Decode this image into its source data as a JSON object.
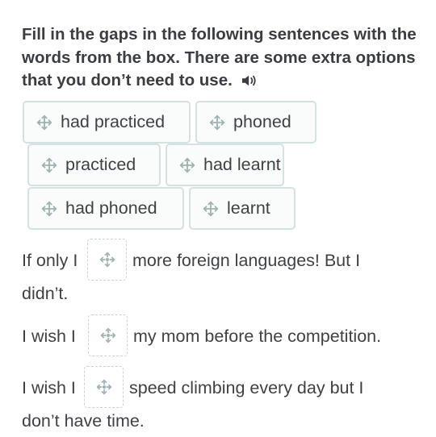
{
  "instructions": "Fill in the gaps in the following sentences with the words from the box. There are some extra options that you don’t need to use.",
  "icons": {
    "audio": "speaker-icon",
    "drag": "move-icon",
    "drop": "drop-target-icon"
  },
  "colors": {
    "chip_border": "#d4e2e2",
    "icon": "#9fb3b3",
    "text": "#3e4247"
  },
  "options": [
    {
      "label": "had practiced"
    },
    {
      "label": "phoned"
    },
    {
      "label": "practiced"
    },
    {
      "label": "had learnt"
    },
    {
      "label": "had phoned"
    },
    {
      "label": "learnt"
    }
  ],
  "sentences": [
    {
      "before": "If only I",
      "after": "more foreign languages! But I",
      "continued": "didn’t."
    },
    {
      "before": "I wish I",
      "after": "my mom before the competition.",
      "continued": ""
    },
    {
      "before": "I wish I",
      "after": "speed climbing every day but I",
      "continued": "don’t have time."
    }
  ]
}
